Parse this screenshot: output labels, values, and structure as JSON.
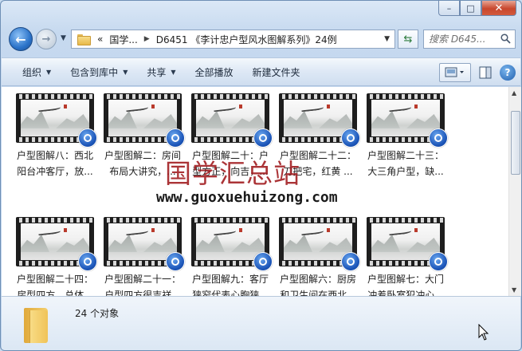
{
  "window": {
    "caption": {
      "minimize": "–",
      "maximize": "□",
      "close": "✕"
    }
  },
  "nav": {
    "breadcrumb_prefix": "«",
    "breadcrumbs": [
      "国学...",
      "D6451 《李计忠户型风水图解系列》24例"
    ],
    "search_placeholder": "搜索 D645..."
  },
  "toolbar": {
    "organize": "组织",
    "include_in_library": "包含到库中",
    "share": "共享",
    "play_all": "全部播放",
    "new_folder": "新建文件夹"
  },
  "files": [
    {
      "line1": "户型图解八：西北",
      "line2": "阳台冲客厅，放..."
    },
    {
      "line1": "户型图解二：房间",
      "line2": "布局大讲究，..."
    },
    {
      "line1": "户型图解二十：户",
      "line2": "型方正，向吉，..."
    },
    {
      "line1": "户型图解二十二：",
      "line2": "刀把宅，红黄 ..."
    },
    {
      "line1": "户型图解二十三：",
      "line2": "大三角户型，缺..."
    },
    {
      "line1": "户型图解二十四：",
      "line2": "房型四方，总体..."
    },
    {
      "line1": "户型图解二十一：",
      "line2": "户型四方很吉祥..."
    },
    {
      "line1": "户型图解九：客厅",
      "line2": "狭窄代表心胸狭..."
    },
    {
      "line1": "户型图解六：厨房",
      "line2": "和卫生间在西北..."
    },
    {
      "line1": "户型图解七：大门",
      "line2": "冲着卧室犯冲心..."
    }
  ],
  "watermark": {
    "chinese": "国学汇总站",
    "url": "www.guoxuehuizong.com"
  },
  "status": {
    "item_count": "24 个对象"
  },
  "colors": {
    "window_frame": "#c6d9ef",
    "toolbar": "#dde8f5",
    "watermark_red": "#a0191c",
    "play_badge": "#1c55b8"
  }
}
